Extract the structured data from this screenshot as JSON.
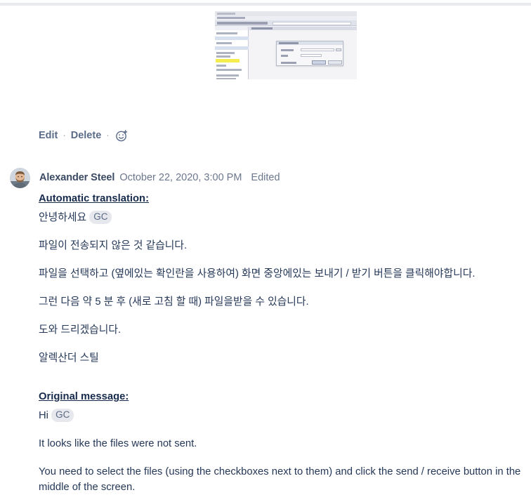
{
  "attachment": {
    "name": "embedded-screenshot",
    "alt": "Screenshot of a desktop email client with a file transfer dialog open and a highlighted row in the sidebar list"
  },
  "actions": {
    "edit_label": "Edit",
    "delete_label": "Delete",
    "separator": "·",
    "reaction_icon": "add-reaction-icon"
  },
  "comment": {
    "author": "Alexander Steel",
    "timestamp": "October 22, 2020, 3:00 PM",
    "edited_label": "Edited",
    "avatar_icon": "user-avatar-photo",
    "translation": {
      "heading": "Automatic translation:",
      "greeting": "안녕하세요",
      "mention": "GC",
      "paragraphs": [
        "파일이 전송되지 않은 것 같습니다.",
        "파일을 선택하고 (옆에있는 확인란을 사용하여) 화면 중앙에있는 보내기 / 받기 버튼을 클릭해야합니다.",
        "그런 다음 약 5 분 후 (새로 고침 할 때) 파일을받을 수 있습니다.",
        "도와 드리겠습니다.",
        "알렉산더 스틸"
      ]
    },
    "original": {
      "heading": "Original message:",
      "greeting": "Hi",
      "mention": "GC",
      "paragraphs": [
        "It looks like the files were not sent.",
        "You need to select the files (using the checkboxes next to them) and click the send / receive button in the middle of the screen."
      ]
    }
  },
  "colors": {
    "body_text": "#253858",
    "heading_text": "#172b4d",
    "author_text": "#3a4a63",
    "meta_text": "#6b778c",
    "link_text": "#5b6c89",
    "mention_bg": "#e7e8ee",
    "mention_text": "#5b6b85",
    "divider": "#e9eaee",
    "highlight_yellow": "#f5ec4e"
  }
}
